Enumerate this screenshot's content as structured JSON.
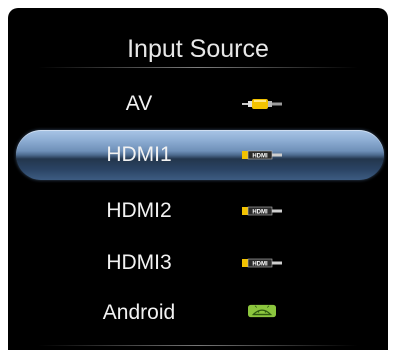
{
  "title": "Input Source",
  "items": [
    {
      "label": "AV",
      "icon": "rca-av-cable-icon",
      "selected": false
    },
    {
      "label": "HDMI1",
      "icon": "hdmi-connector-icon",
      "selected": true
    },
    {
      "label": "HDMI2",
      "icon": "hdmi-connector-icon",
      "selected": false
    },
    {
      "label": "HDMI3",
      "icon": "hdmi-connector-icon",
      "selected": false
    },
    {
      "label": "Android",
      "icon": "android-logo-icon",
      "selected": false
    }
  ],
  "icon_text": {
    "hdmi": "HDMI"
  },
  "colors": {
    "background": "#000000",
    "text": "#f2f2f2",
    "selection": "#4d6b8f",
    "av_plug": "#f2c200",
    "android": "#8cc63e"
  }
}
